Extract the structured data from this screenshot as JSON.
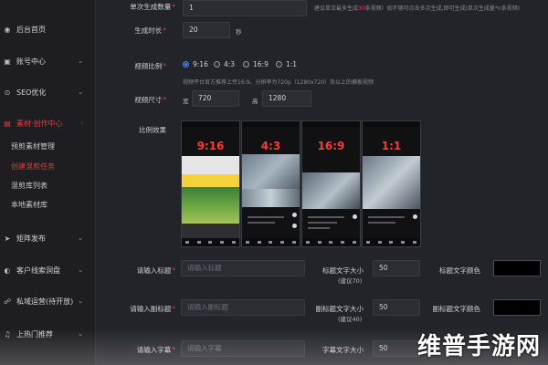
{
  "sidebar": {
    "items": [
      {
        "label": "后台首页",
        "icon": "dashboard-icon"
      },
      {
        "label": "账号中心",
        "icon": "account-icon"
      },
      {
        "label": "SEO优化",
        "icon": "seo-icon"
      },
      {
        "label": "素材·创作中心",
        "icon": "material-icon"
      },
      {
        "label": "矩阵发布",
        "icon": "publish-icon"
      },
      {
        "label": "客户线索洞盘",
        "icon": "leads-icon"
      },
      {
        "label": "私域运营(待开放)",
        "icon": "private-domain-icon"
      },
      {
        "label": "上热门推荐",
        "icon": "bell-icon"
      }
    ],
    "subitems": [
      {
        "label": "预剪素材管理"
      },
      {
        "label": "创建混剪任务"
      },
      {
        "label": "混剪库列表"
      },
      {
        "label": "本地素材库"
      }
    ]
  },
  "form": {
    "count_label": "单次生成数量",
    "count_value": "1",
    "count_hint_pre": "建议单次最多生成",
    "count_hint_num": "30",
    "count_hint_post": "条视频）如不够可点击多次生成,即可生成(单次生成量*n条视频)",
    "duration_label": "生成时长",
    "duration_value": "20",
    "duration_unit": "秒",
    "ratio_label": "视频比例",
    "ratio_options": [
      "9:16",
      "4:3",
      "16:9",
      "1:1"
    ],
    "ratio_selected": "9:16",
    "ratio_hint": "视频平台官方推荐上传16:9、分辨率为720p（1280x720）及以上的横板视频",
    "size_label": "视频尺寸",
    "width_prefix": "宽",
    "width_value": "720",
    "height_prefix": "高",
    "height_value": "1280",
    "preview_label": "比例效果",
    "previews": [
      "9:16",
      "4:3",
      "16:9",
      "1:1"
    ],
    "title_label": "请输入标题",
    "title_placeholder": "请输入标题",
    "title_size_label": "标题文字大小",
    "title_size_hint": "(建议70)",
    "title_size_value": "50",
    "title_color_label": "标题文字颜色",
    "subtitle_label": "请输入副标题",
    "subtitle_placeholder": "请输入副标题",
    "subtitle_size_label": "副标题文字大小",
    "subtitle_size_hint": "(建议40)",
    "subtitle_size_value": "50",
    "subtitle_color_label": "副标题文字颜色",
    "caption_label": "请输入字幕",
    "caption_placeholder": "请输入字幕",
    "caption_size_label": "字幕文字大小",
    "caption_size_value": "50"
  },
  "watermark": "维普手游网",
  "colors": {
    "accent": "#e0403e",
    "radio": "#4a8cff",
    "title_color": "#000000",
    "subtitle_color": "#000000"
  }
}
